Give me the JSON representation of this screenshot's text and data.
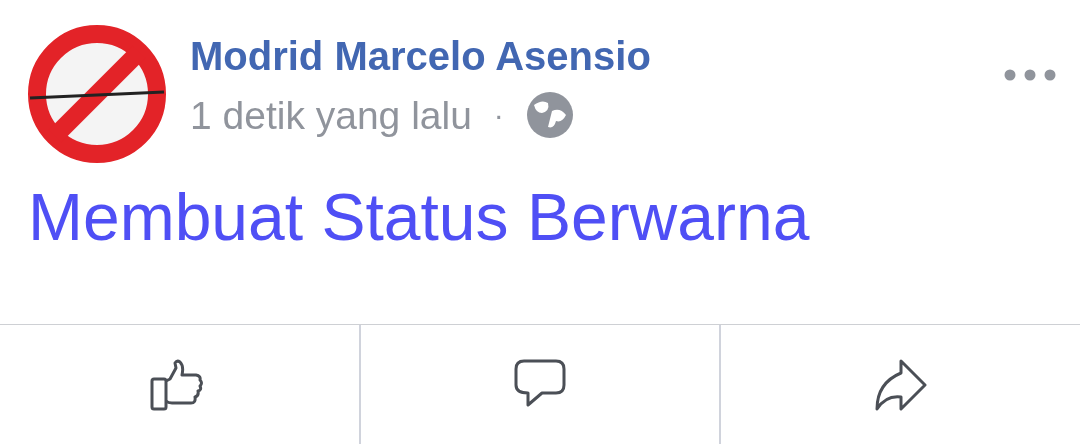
{
  "post": {
    "author": "Modrid Marcelo Asensio",
    "time": "1 detik yang lalu",
    "separator": "·",
    "text": "Membuat Status Berwarna"
  },
  "actions": [
    {
      "kind": "like"
    },
    {
      "kind": "comment"
    },
    {
      "kind": "share"
    }
  ]
}
